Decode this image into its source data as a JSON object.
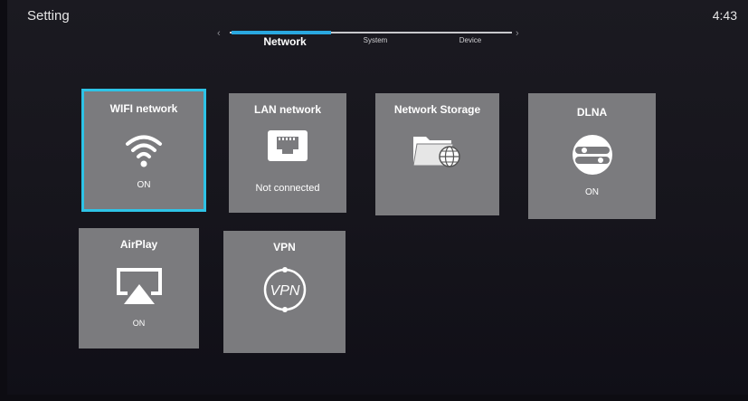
{
  "header": {
    "title": "Setting",
    "time": "4:43"
  },
  "tabs": [
    {
      "label": "Network",
      "active": true
    },
    {
      "label": "System",
      "active": false
    },
    {
      "label": "Device",
      "active": false
    }
  ],
  "tiles": [
    {
      "label": "WIFI network",
      "status": "ON",
      "icon": "wifi-icon",
      "focused": true
    },
    {
      "label": "LAN network",
      "status": "Not connected",
      "icon": "ethernet-port-icon"
    },
    {
      "label": "Network Storage",
      "status": "",
      "icon": "folder-globe-icon"
    },
    {
      "label": "DLNA",
      "status": "ON",
      "icon": "dlna-icon"
    },
    {
      "label": "AirPlay",
      "status": "ON",
      "icon": "airplay-icon"
    },
    {
      "label": "VPN",
      "status": "",
      "icon": "vpn-icon"
    }
  ],
  "colors": {
    "accent": "#2ec3e6",
    "tile": "#7b7b7e",
    "background": "#16151c"
  }
}
